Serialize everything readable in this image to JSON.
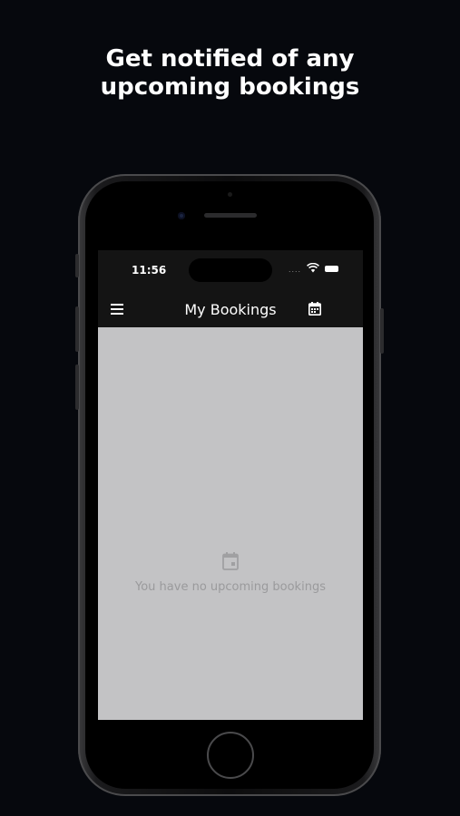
{
  "promo": {
    "headline_line1": "Get notified of any",
    "headline_line2": "upcoming bookings"
  },
  "status_bar": {
    "time": "11:56",
    "signal": "....",
    "icons": [
      "wifi-icon",
      "battery-icon"
    ]
  },
  "app_bar": {
    "title": "My Bookings",
    "left_icon": "menu-icon",
    "right_icon": "calendar-icon"
  },
  "main": {
    "empty_icon": "calendar-event-icon",
    "empty_message": "You have no upcoming bookings",
    "background_color": "#c3c3c5"
  },
  "colors": {
    "page_background": "#06080d",
    "app_bar_background": "#141414",
    "empty_text": "#9a9a9c"
  }
}
